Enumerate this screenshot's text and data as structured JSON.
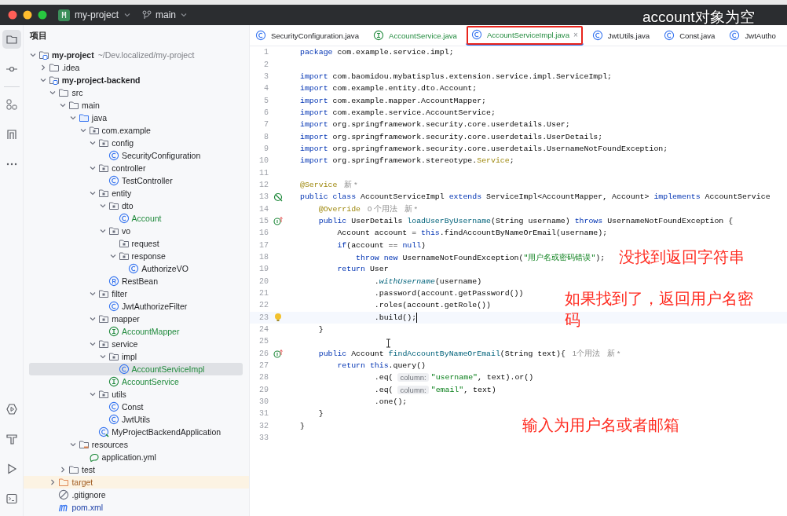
{
  "title_bar": {
    "project": {
      "badge": "M",
      "name": "my-project"
    },
    "branch": "main",
    "subtitle": "account对象为空"
  },
  "tool_rail": {
    "top": [
      {
        "kind": "project",
        "selected": true
      },
      {
        "kind": "commit",
        "selected": false
      },
      {
        "kind": "structure",
        "selected": false
      },
      {
        "kind": "bookmarks",
        "selected": false
      },
      {
        "kind": "more",
        "selected": false
      }
    ],
    "bottom": [
      {
        "kind": "services",
        "selected": false
      },
      {
        "kind": "build",
        "selected": false
      },
      {
        "kind": "run",
        "selected": false
      },
      {
        "kind": "terminal",
        "selected": false
      }
    ]
  },
  "project_panel": {
    "title": "项目",
    "tree": [
      {
        "label": "my-project",
        "path": "~/Dev.localized/my-project",
        "kind": "module",
        "expanded": true,
        "selected": false,
        "children": [
          {
            "label": ".idea",
            "kind": "folder",
            "expanded": false,
            "selected": false
          },
          {
            "label": "my-project-backend",
            "kind": "module",
            "expanded": true,
            "selected": false,
            "children": [
              {
                "label": "src",
                "kind": "folder",
                "expanded": true,
                "selected": false,
                "children": [
                  {
                    "label": "main",
                    "kind": "folder",
                    "expanded": true,
                    "selected": false,
                    "children": [
                      {
                        "label": "java",
                        "kind": "source-folder",
                        "expanded": true,
                        "selected": false,
                        "children": [
                          {
                            "label": "com.example",
                            "kind": "package",
                            "expanded": true,
                            "selected": false,
                            "children": [
                              {
                                "label": "config",
                                "kind": "package",
                                "expanded": true,
                                "selected": false,
                                "children": [
                                  {
                                    "label": "SecurityConfiguration",
                                    "kind": "class",
                                    "added": false,
                                    "selected": false
                                  }
                                ]
                              },
                              {
                                "label": "controller",
                                "kind": "package",
                                "expanded": true,
                                "selected": false,
                                "children": [
                                  {
                                    "label": "TestController",
                                    "kind": "class",
                                    "added": false,
                                    "selected": false
                                  }
                                ]
                              },
                              {
                                "label": "entity",
                                "kind": "package",
                                "expanded": true,
                                "selected": false,
                                "children": [
                                  {
                                    "label": "dto",
                                    "kind": "package",
                                    "expanded": true,
                                    "selected": false,
                                    "children": [
                                      {
                                        "label": "Account",
                                        "kind": "class",
                                        "added": true,
                                        "selected": false
                                      }
                                    ]
                                  },
                                  {
                                    "label": "vo",
                                    "kind": "package",
                                    "expanded": true,
                                    "selected": false,
                                    "children": [
                                      {
                                        "label": "request",
                                        "kind": "package",
                                        "selected": false
                                      },
                                      {
                                        "label": "response",
                                        "kind": "package",
                                        "expanded": true,
                                        "selected": false,
                                        "children": [
                                          {
                                            "label": "AuthorizeVO",
                                            "kind": "class",
                                            "added": false,
                                            "selected": false
                                          }
                                        ]
                                      }
                                    ]
                                  },
                                  {
                                    "label": "RestBean",
                                    "kind": "record",
                                    "added": false,
                                    "selected": false
                                  }
                                ]
                              },
                              {
                                "label": "filter",
                                "kind": "package",
                                "expanded": true,
                                "selected": false,
                                "children": [
                                  {
                                    "label": "JwtAuthorizeFilter",
                                    "kind": "class",
                                    "added": false,
                                    "selected": false
                                  }
                                ]
                              },
                              {
                                "label": "mapper",
                                "kind": "package",
                                "expanded": true,
                                "selected": false,
                                "children": [
                                  {
                                    "label": "AccountMapper",
                                    "kind": "interface",
                                    "added": true,
                                    "selected": false
                                  }
                                ]
                              },
                              {
                                "label": "service",
                                "kind": "package",
                                "expanded": true,
                                "selected": false,
                                "children": [
                                  {
                                    "label": "impl",
                                    "kind": "package",
                                    "expanded": true,
                                    "selected": false,
                                    "children": [
                                      {
                                        "label": "AccountServiceImpl",
                                        "kind": "class",
                                        "added": true,
                                        "selected": true
                                      }
                                    ]
                                  },
                                  {
                                    "label": "AccountService",
                                    "kind": "interface",
                                    "added": true,
                                    "selected": false
                                  }
                                ]
                              },
                              {
                                "label": "utils",
                                "kind": "package",
                                "expanded": true,
                                "selected": false,
                                "children": [
                                  {
                                    "label": "Const",
                                    "kind": "class",
                                    "added": false,
                                    "selected": false
                                  },
                                  {
                                    "label": "JwtUtils",
                                    "kind": "class",
                                    "added": false,
                                    "selected": false
                                  }
                                ]
                              },
                              {
                                "label": "MyProjectBackendApplication",
                                "kind": "application",
                                "added": false,
                                "selected": false
                              }
                            ]
                          }
                        ]
                      },
                      {
                        "label": "resources",
                        "kind": "resources-folder",
                        "expanded": true,
                        "selected": false,
                        "children": [
                          {
                            "label": "application.yml",
                            "kind": "yaml",
                            "selected": false
                          }
                        ]
                      }
                    ]
                  },
                  {
                    "label": "test",
                    "kind": "folder",
                    "expanded": false,
                    "selected": false
                  }
                ]
              },
              {
                "label": "target",
                "kind": "excluded-folder",
                "expanded": false,
                "selected": false
              },
              {
                "label": ".gitignore",
                "kind": "ignore-file",
                "selected": false
              },
              {
                "label": "pom.xml",
                "kind": "maven",
                "selected": false
              }
            ]
          }
        ]
      }
    ]
  },
  "editor": {
    "tabs": [
      {
        "label": "SecurityConfiguration.java",
        "kind": "class",
        "added": false,
        "selected": false,
        "highlighted": false
      },
      {
        "label": "AccountService.java",
        "kind": "interface",
        "added": true,
        "selected": false,
        "highlighted": false
      },
      {
        "label": "AccountServiceImpl.java",
        "kind": "class",
        "added": true,
        "selected": true,
        "highlighted": true,
        "close": "×"
      },
      {
        "label": "JwtUtils.java",
        "kind": "class",
        "added": false,
        "selected": false,
        "highlighted": false
      },
      {
        "label": "Const.java",
        "kind": "class",
        "added": false,
        "selected": false,
        "highlighted": false
      },
      {
        "label": "JwtAutho",
        "kind": "class",
        "added": false,
        "selected": false,
        "highlighted": false
      }
    ],
    "lines": [
      {
        "number": "1",
        "tokens": [
          {
            "t": "package",
            "kind": "kw"
          },
          {
            "t": " com.example.service.impl;",
            "kind": "plain"
          }
        ]
      },
      {
        "number": "2"
      },
      {
        "number": "3",
        "tokens": [
          {
            "t": "import",
            "kind": "kw"
          },
          {
            "t": " com.baomidou.mybatisplus.extension.service.impl.ServiceImpl;",
            "kind": "plain"
          }
        ]
      },
      {
        "number": "4",
        "tokens": [
          {
            "t": "import",
            "kind": "kw"
          },
          {
            "t": " com.example.entity.dto.Account;",
            "kind": "plain"
          }
        ]
      },
      {
        "number": "5",
        "tokens": [
          {
            "t": "import",
            "kind": "kw"
          },
          {
            "t": " com.example.mapper.AccountMapper;",
            "kind": "plain"
          }
        ]
      },
      {
        "number": "6",
        "tokens": [
          {
            "t": "import",
            "kind": "kw"
          },
          {
            "t": " com.example.service.AccountService;",
            "kind": "plain"
          }
        ]
      },
      {
        "number": "7",
        "tokens": [
          {
            "t": "import",
            "kind": "kw"
          },
          {
            "t": " org.springframework.security.core.userdetails.User;",
            "kind": "plain"
          }
        ]
      },
      {
        "number": "8",
        "tokens": [
          {
            "t": "import",
            "kind": "kw"
          },
          {
            "t": " org.springframework.security.core.userdetails.UserDetails;",
            "kind": "plain"
          }
        ]
      },
      {
        "number": "9",
        "tokens": [
          {
            "t": "import",
            "kind": "kw"
          },
          {
            "t": " org.springframework.security.core.userdetails.UsernameNotFoundException;",
            "kind": "plain"
          }
        ]
      },
      {
        "number": "10",
        "tokens": [
          {
            "t": "import",
            "kind": "kw"
          },
          {
            "t": " org.springframework.stereotype.",
            "kind": "plain"
          },
          {
            "t": "Service",
            "kind": "ann"
          },
          {
            "t": ";",
            "kind": "plain"
          }
        ]
      },
      {
        "number": "11"
      },
      {
        "number": "12",
        "tokens": [
          {
            "t": "@Service",
            "kind": "ann"
          },
          {
            "t": "新 *",
            "kind": "hint"
          }
        ]
      },
      {
        "number": "13",
        "gutter": {
          "kind": "implemented"
        },
        "tokens": [
          {
            "t": "public class",
            "kind": "kw"
          },
          {
            "t": " AccountServiceImpl ",
            "kind": "plain"
          },
          {
            "t": "extends",
            "kind": "kw"
          },
          {
            "t": " ServiceImpl<AccountMapper, Account> ",
            "kind": "plain"
          },
          {
            "t": "implements",
            "kind": "kw"
          },
          {
            "t": " AccountService",
            "kind": "plain"
          }
        ]
      },
      {
        "number": "14",
        "tokens": [
          {
            "t": "    @Override",
            "kind": "ann"
          },
          {
            "t": "0 个用法",
            "kind": "hint"
          },
          {
            "t": "新 *",
            "kind": "hint"
          }
        ]
      },
      {
        "number": "15",
        "gutter": {
          "kind": "overrides"
        },
        "tokens": [
          {
            "t": "    public",
            "kind": "kw"
          },
          {
            "t": " UserDetails ",
            "kind": "plain"
          },
          {
            "t": "loadUserByUsername",
            "kind": "decl"
          },
          {
            "t": "(String username) ",
            "kind": "plain"
          },
          {
            "t": "throws",
            "kind": "kw"
          },
          {
            "t": " UsernameNotFoundException {",
            "kind": "plain"
          }
        ]
      },
      {
        "number": "16",
        "tokens": [
          {
            "t": "        Account account = ",
            "kind": "plain"
          },
          {
            "t": "this",
            "kind": "kw"
          },
          {
            "t": ".findAccountByNameOrEmail(username);",
            "kind": "plain"
          }
        ]
      },
      {
        "number": "17",
        "tokens": [
          {
            "t": "        if",
            "kind": "kw"
          },
          {
            "t": "(account == ",
            "kind": "plain"
          },
          {
            "t": "null",
            "kind": "kw"
          },
          {
            "t": ")",
            "kind": "plain"
          }
        ]
      },
      {
        "number": "18",
        "tokens": [
          {
            "t": "            throw new",
            "kind": "kw"
          },
          {
            "t": " UsernameNotFoundException(",
            "kind": "plain"
          },
          {
            "t": "\"用户名或密码错误\"",
            "kind": "str"
          },
          {
            "t": ");",
            "kind": "plain"
          }
        ]
      },
      {
        "number": "19",
        "tokens": [
          {
            "t": "        return",
            "kind": "kw"
          },
          {
            "t": " User",
            "kind": "plain"
          }
        ]
      },
      {
        "number": "20",
        "tokens": [
          {
            "t": "                .",
            "kind": "plain"
          },
          {
            "t": "withUsername",
            "kind": "static"
          },
          {
            "t": "(username)",
            "kind": "plain"
          }
        ]
      },
      {
        "number": "21",
        "tokens": [
          {
            "t": "                .password(account.getPassword())",
            "kind": "plain"
          }
        ]
      },
      {
        "number": "22",
        "tokens": [
          {
            "t": "                .roles(account.getRole())",
            "kind": "plain"
          }
        ]
      },
      {
        "number": "23",
        "gutter": {
          "kind": "bulb"
        },
        "current": true,
        "caret": true,
        "tokens": [
          {
            "t": "                .build();",
            "kind": "plain"
          }
        ]
      },
      {
        "number": "24",
        "tokens": [
          {
            "t": "    }",
            "kind": "plain"
          }
        ]
      },
      {
        "number": "25"
      },
      {
        "number": "26",
        "gutter": {
          "kind": "overrides"
        },
        "tokens": [
          {
            "t": "    public",
            "kind": "kw"
          },
          {
            "t": " Account ",
            "kind": "plain"
          },
          {
            "t": "findAccountByNameOrEmail",
            "kind": "decl"
          },
          {
            "t": "(String text){",
            "kind": "plain"
          },
          {
            "t": "1个用法",
            "kind": "hint"
          },
          {
            "t": "新 *",
            "kind": "hint"
          }
        ]
      },
      {
        "number": "27",
        "tokens": [
          {
            "t": "        return this",
            "kind": "kw"
          },
          {
            "t": ".query()",
            "kind": "plain"
          }
        ]
      },
      {
        "number": "28",
        "tokens": [
          {
            "t": "                .eq( ",
            "kind": "plain"
          },
          {
            "t": "column:",
            "kind": "param"
          },
          {
            "t": "\"username\"",
            "kind": "str"
          },
          {
            "t": ", text).or()",
            "kind": "plain"
          }
        ]
      },
      {
        "number": "29",
        "tokens": [
          {
            "t": "                .eq( ",
            "kind": "plain"
          },
          {
            "t": "column:",
            "kind": "param"
          },
          {
            "t": "\"email\"",
            "kind": "str"
          },
          {
            "t": ", text)",
            "kind": "plain"
          }
        ]
      },
      {
        "number": "30",
        "tokens": [
          {
            "t": "                .one();",
            "kind": "plain"
          }
        ]
      },
      {
        "number": "31",
        "tokens": [
          {
            "t": "    }",
            "kind": "plain"
          }
        ]
      },
      {
        "number": "32",
        "tokens": [
          {
            "t": "}",
            "kind": "plain"
          }
        ]
      },
      {
        "number": "33"
      }
    ],
    "annotations": [
      {
        "text": "没找到返回字符串",
        "kind": "note-1"
      },
      {
        "text": "如果找到了，返回用户名密码",
        "kind": "note-2"
      },
      {
        "text": "输入为用户名或者邮箱",
        "kind": "note-3"
      }
    ]
  }
}
